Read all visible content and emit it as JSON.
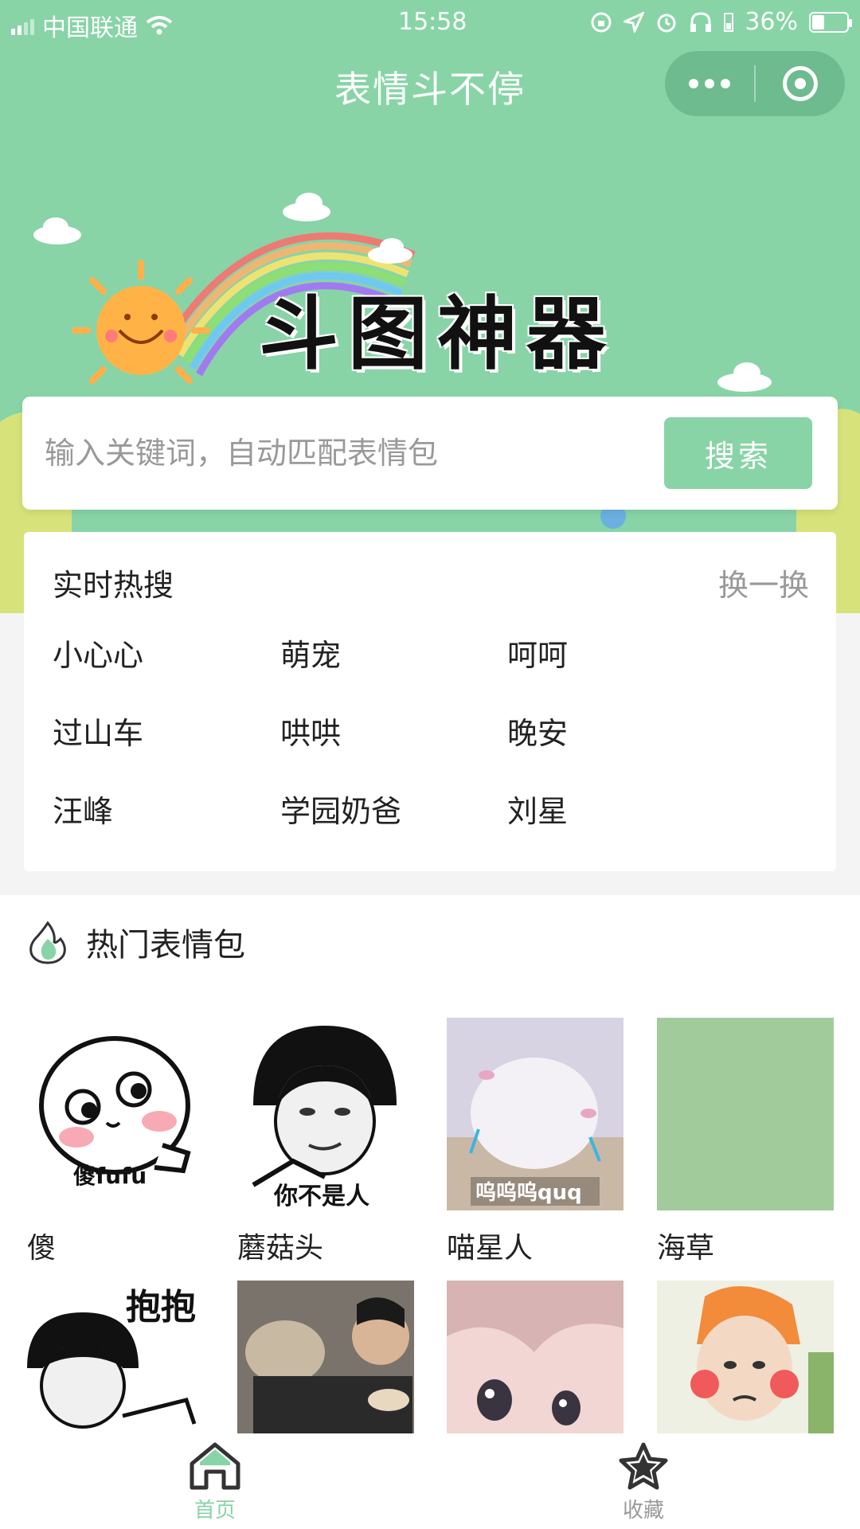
{
  "status_bar": {
    "carrier": "中国联通",
    "time": "15:58",
    "battery": "36%",
    "battery_level": 0.36
  },
  "app": {
    "title": "表情斗不停"
  },
  "banner": {
    "heading": "斗图神器"
  },
  "search": {
    "placeholder": "输入关键词，自动匹配表情包",
    "button_label": "搜索"
  },
  "hot_search": {
    "title": "实时热搜",
    "refresh_label": "换一换",
    "items": [
      "小心心",
      "萌宠",
      "呵呵",
      "过山车",
      "哄哄",
      "晚安",
      "汪峰",
      "学园奶爸",
      "刘星"
    ]
  },
  "popular": {
    "title": "热门表情包",
    "stickers": [
      {
        "label": "傻",
        "caption": "傻fufu"
      },
      {
        "label": "蘑菇头",
        "caption": "你不是人"
      },
      {
        "label": "喵星人",
        "caption": "呜呜呜quq"
      },
      {
        "label": "海草",
        "caption": ""
      },
      {
        "label": "",
        "caption": "抱抱"
      },
      {
        "label": "",
        "caption": ""
      },
      {
        "label": "",
        "caption": ""
      },
      {
        "label": "",
        "caption": ""
      }
    ]
  },
  "tabbar": {
    "home_label": "首页",
    "favorites_label": "收藏",
    "active_color": "#88d4a7",
    "inactive_color": "#999999"
  },
  "colors": {
    "brand_green": "#88d4a7"
  }
}
